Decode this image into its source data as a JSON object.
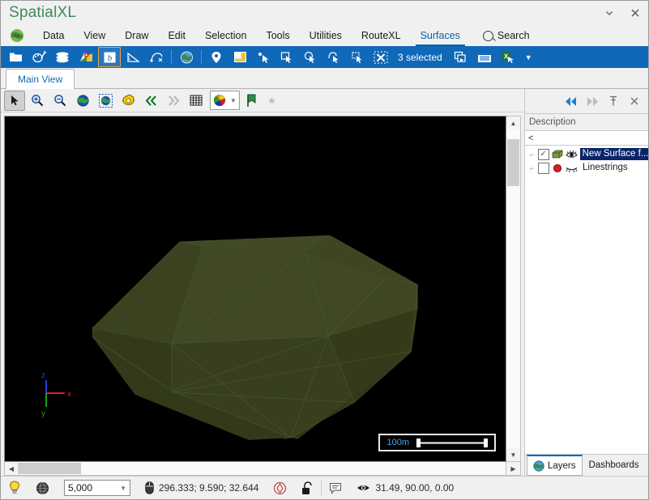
{
  "window": {
    "title": "SpatialXL",
    "dropdown_icon": "chevron-down-icon",
    "close_icon": "close-icon"
  },
  "menu": {
    "logo_icon": "globe-ab-logo-icon",
    "items": [
      {
        "label": "Data",
        "active": false
      },
      {
        "label": "View",
        "active": false
      },
      {
        "label": "Draw",
        "active": false
      },
      {
        "label": "Edit",
        "active": false
      },
      {
        "label": "Selection",
        "active": false
      },
      {
        "label": "Tools",
        "active": false
      },
      {
        "label": "Utilities",
        "active": false
      },
      {
        "label": "RouteXL",
        "active": false
      },
      {
        "label": "Surfaces",
        "active": true
      }
    ],
    "search_label": "Search",
    "search_icon": "search-icon"
  },
  "toolbar": {
    "background": "#1068b8",
    "selection_count_label": "3 selected",
    "items": [
      {
        "name": "open-folder-icon"
      },
      {
        "name": "palette-brush-icon"
      },
      {
        "name": "layers-stack-icon"
      },
      {
        "name": "map-pin-icon"
      },
      {
        "name": "blue-b-icon"
      },
      {
        "name": "triangle-measure-icon"
      },
      {
        "name": "curve-node-icon"
      },
      {
        "name": "globe-icon"
      },
      {
        "name": "location-pin-icon"
      },
      {
        "name": "window-snip-icon"
      },
      {
        "name": "select-point-icon"
      },
      {
        "name": "select-rectangle-icon"
      },
      {
        "name": "select-circle-icon"
      },
      {
        "name": "select-lasso-icon"
      },
      {
        "name": "select-polygon-icon"
      },
      {
        "name": "clear-selection-icon"
      },
      {
        "name": "copy-selection-icon"
      },
      {
        "name": "table-view-icon"
      },
      {
        "name": "excel-export-icon"
      },
      {
        "name": "overflow-caret-icon"
      }
    ]
  },
  "document_tabs": [
    {
      "label": "Main View",
      "active": true
    }
  ],
  "view_toolbar": {
    "items": [
      {
        "name": "pointer-select-icon",
        "pressed": true
      },
      {
        "name": "zoom-in-icon",
        "pressed": false
      },
      {
        "name": "zoom-out-icon",
        "pressed": false
      },
      {
        "name": "globe-zoom-extent-icon",
        "pressed": false
      },
      {
        "name": "globe-zoom-selection-icon",
        "pressed": false
      },
      {
        "name": "settings-gear-icon",
        "pressed": false
      },
      {
        "name": "previous-view-icon",
        "pressed": false
      },
      {
        "name": "next-view-icon",
        "pressed": false,
        "dim": true
      },
      {
        "name": "grid-icon",
        "pressed": false
      },
      {
        "name": "color-palette-dropdown-icon",
        "pressed": false
      },
      {
        "name": "bookmark-flag-icon",
        "pressed": false
      },
      {
        "name": "favorite-star-icon",
        "pressed": false,
        "dim": true
      }
    ]
  },
  "viewport": {
    "background": "#000000",
    "surface_color": "#3a4020",
    "surface_edge_color": "#4d5a2a",
    "scalebar": {
      "label": "100m"
    },
    "axis_gizmo": {
      "x_label": "x",
      "y_label": "y",
      "z_label": "z",
      "x_color": "#e02020",
      "y_color": "#18a018",
      "z_color": "#2040e8"
    },
    "scrollbars": {
      "up_arrow": "chevron-up-icon",
      "down_arrow": "chevron-down-icon",
      "left_arrow": "chevron-left-icon",
      "right_arrow": "chevron-right-icon"
    }
  },
  "right_panel": {
    "header_buttons": [
      {
        "name": "collapse-left-icon",
        "glyph": "◀◀",
        "style": "blue"
      },
      {
        "name": "collapse-right-icon",
        "glyph": "▶▶",
        "style": "dim"
      },
      {
        "name": "pin-icon",
        "glyph": "✠",
        "style": "normal"
      },
      {
        "name": "close-panel-icon",
        "glyph": "✕",
        "style": "normal"
      }
    ],
    "column_header": "Description",
    "filter_text": "<",
    "layers": [
      {
        "label": "New Surface f...",
        "checked": true,
        "selected": true,
        "symbol_icon": "green-surface-box-icon",
        "symbol_color": "#7a9a40",
        "visibility_icon": "eye-open-icon"
      },
      {
        "label": "Linestrings",
        "checked": false,
        "selected": false,
        "symbol_icon": "red-circle-icon",
        "symbol_color": "#d42020",
        "visibility_icon": "eye-closed-icon"
      }
    ],
    "tabs": [
      {
        "label": "Layers",
        "active": true,
        "icon": "globe-icon"
      },
      {
        "label": "Dashboards",
        "active": false,
        "icon": ""
      }
    ]
  },
  "status_bar": {
    "light_bulb_icon": "light-bulb-icon",
    "globe_icon": "globe-wire-icon",
    "scale_value": "5,000",
    "scale_caret": "chevron-down-icon",
    "mouse_icon": "mouse-icon",
    "coordinates": "296.333; 9.590; 32.644",
    "target_icon": "target-icon",
    "lock_icon": "unlocked-padlock-icon",
    "note_icon": "note-icon",
    "eye_icon": "eye-open-icon",
    "camera_angles": "31.49, 90.00, 0.00"
  }
}
